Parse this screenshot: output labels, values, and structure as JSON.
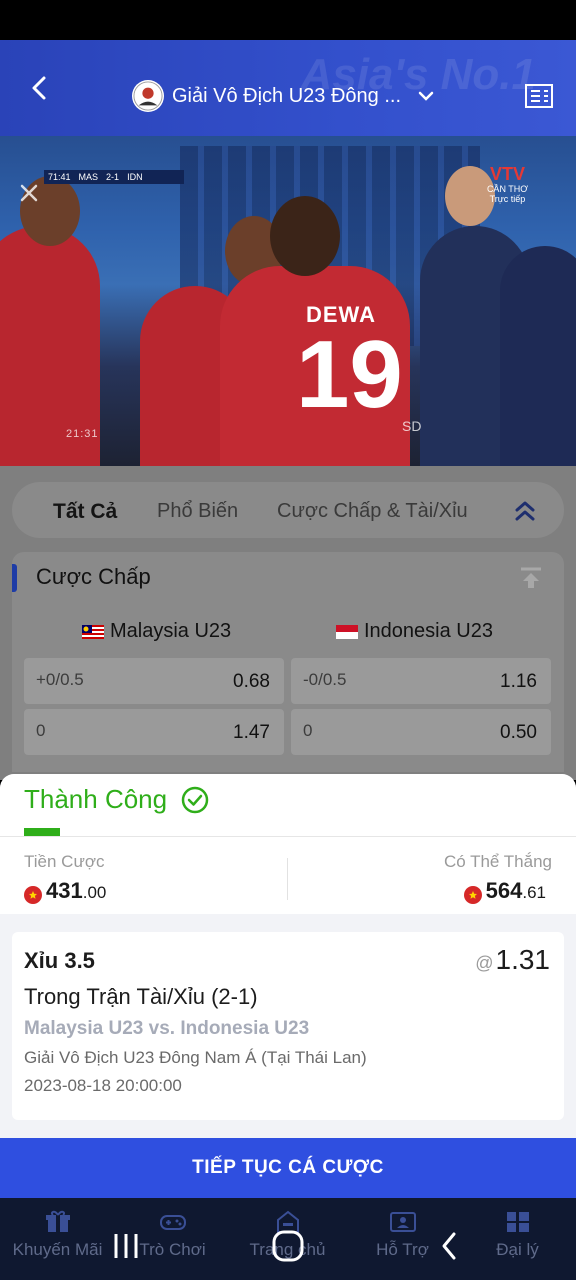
{
  "header": {
    "back_icon": "chevron-left-icon",
    "league_title": "Giải Vô Địch U23 Đông ...",
    "dropdown_icon": "chevron-down-icon",
    "news_icon": "news-icon",
    "watermark": "Asia's No.1"
  },
  "video": {
    "scorebug": {
      "clock": "71:41",
      "home": "MAS",
      "score": "2-1",
      "away": "IDN"
    },
    "channel": "VTV",
    "channel_sub1": "CẦN THƠ",
    "channel_sub2": "Trực tiếp",
    "jersey_name": "DEWA",
    "jersey_number": "19",
    "clock_overlay": "21:31",
    "quality": "SD"
  },
  "tabs": {
    "items": [
      "Tất Cả",
      "Phổ Biến",
      "Cược Chấp & Tài/Xỉu"
    ],
    "active": "Tất Cả"
  },
  "handicap": {
    "title": "Cược Chấp",
    "home_team": "Malaysia U23",
    "away_team": "Indonesia U23",
    "rows": [
      {
        "home_hcp": "+0/0.5",
        "home_odds": "0.68",
        "away_hcp": "-0/0.5",
        "away_odds": "1.16"
      },
      {
        "home_hcp": "0",
        "home_odds": "1.47",
        "away_hcp": "0",
        "away_odds": "0.50"
      }
    ]
  },
  "result": {
    "status": "Thành Công",
    "stake_label": "Tiền Cược",
    "stake_int": "431",
    "stake_dec": ".00",
    "win_label": "Có Thể Thắng",
    "win_int": "564",
    "win_dec": ".61"
  },
  "bet": {
    "selection": "Xỉu 3.5",
    "at": "@",
    "price": "1.31",
    "market": "Trong Trận Tài/Xỉu (2-1)",
    "match": "Malaysia U23 vs. Indonesia U23",
    "league": "Giải Vô Địch U23 Đông Nam Á (Tại Thái Lan)",
    "datetime": "2023-08-18 20:00:00"
  },
  "cta_label": "TIẾP TỤC CÁ CƯỢC",
  "nav": [
    {
      "label": "Khuyến Mãi",
      "icon": "gift-icon"
    },
    {
      "label": "Trò Chơi",
      "icon": "gamepad-icon"
    },
    {
      "label": "Trang chủ",
      "icon": "home-icon"
    },
    {
      "label": "Hỗ Trợ",
      "icon": "support-icon"
    },
    {
      "label": "Đại lý",
      "icon": "agent-icon"
    }
  ],
  "colors": {
    "brand": "#2f4fe0",
    "success": "#2fae1a",
    "header": "#3350cc"
  }
}
